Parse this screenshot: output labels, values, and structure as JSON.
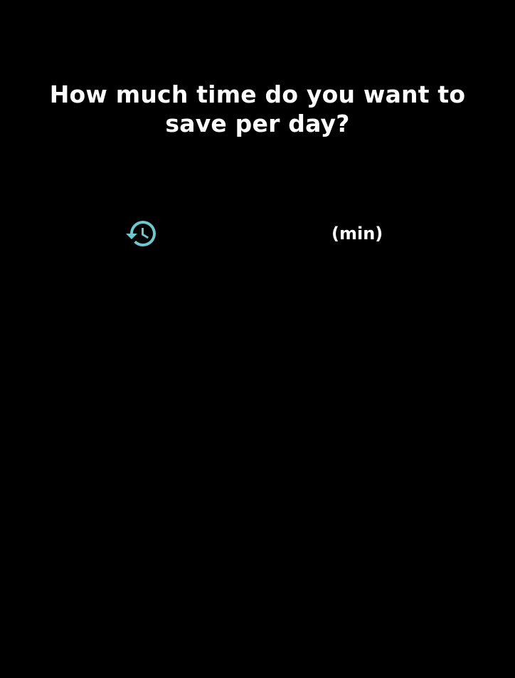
{
  "question": {
    "title": "How much time do you want to save per day?"
  },
  "time_input": {
    "icon": "history-icon",
    "value": "",
    "unit_label": "(min)"
  },
  "colors": {
    "background": "#000000",
    "text": "#ffffff",
    "accent": "#6ec6cf"
  }
}
